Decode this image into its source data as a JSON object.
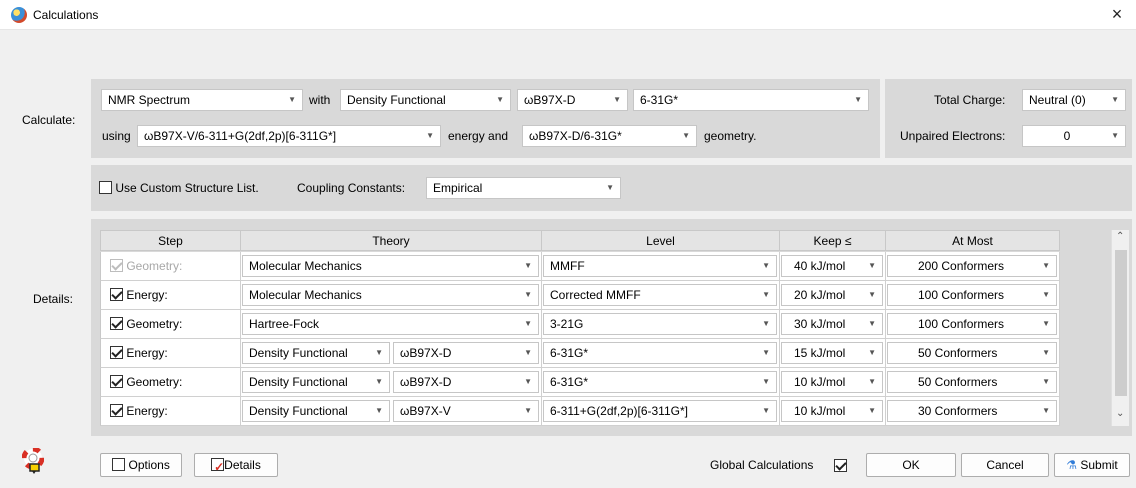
{
  "window": {
    "title": "Calculations",
    "close_glyph": "×"
  },
  "calc": {
    "label": "Calculate:",
    "type": "NMR Spectrum",
    "with": "with",
    "method": "Density Functional",
    "functional": "ωB97X-D",
    "basis": "6-31G*",
    "using": "using",
    "energy_model": "ωB97X-V/6-311+G(2df,2p)[6-311G*]",
    "energy_and": "energy and",
    "geometry_model": "ωB97X-D/6-31G*",
    "geometry": "geometry.",
    "total_charge_label": "Total Charge:",
    "total_charge": "Neutral (0)",
    "unpaired_label": "Unpaired Electrons:",
    "unpaired": "0"
  },
  "options_row": {
    "custom_list": "Use Custom Structure List.",
    "coupling_label": "Coupling Constants:",
    "coupling": "Empirical"
  },
  "details": {
    "label": "Details:",
    "headers": {
      "step": "Step",
      "theory": "Theory",
      "level": "Level",
      "keep": "Keep ≤",
      "atmost": "At Most"
    },
    "rows": [
      {
        "step": "Geometry:",
        "theory": "Molecular Mechanics",
        "functional": "",
        "level": "MMFF",
        "keep": "40 kJ/mol",
        "atmost": "200 Conformers"
      },
      {
        "step": "Energy:",
        "theory": "Molecular Mechanics",
        "functional": "",
        "level": "Corrected MMFF",
        "keep": "20 kJ/mol",
        "atmost": "100 Conformers"
      },
      {
        "step": "Geometry:",
        "theory": "Hartree-Fock",
        "functional": "",
        "level": "3-21G",
        "keep": "30 kJ/mol",
        "atmost": "100 Conformers"
      },
      {
        "step": "Energy:",
        "theory": "Density Functional",
        "functional": "ωB97X-D",
        "level": "6-31G*",
        "keep": "15 kJ/mol",
        "atmost": "50 Conformers"
      },
      {
        "step": "Geometry:",
        "theory": "Density Functional",
        "functional": "ωB97X-D",
        "level": "6-31G*",
        "keep": "10 kJ/mol",
        "atmost": "50 Conformers"
      },
      {
        "step": "Energy:",
        "theory": "Density Functional",
        "functional": "ωB97X-V",
        "level": "6-311+G(2df,2p)[6-311G*]",
        "keep": "10 kJ/mol",
        "atmost": "30 Conformers"
      }
    ]
  },
  "footer": {
    "options": "Options",
    "details": "Details",
    "global": "Global Calculations",
    "ok": "OK",
    "cancel": "Cancel",
    "submit": "Submit"
  }
}
